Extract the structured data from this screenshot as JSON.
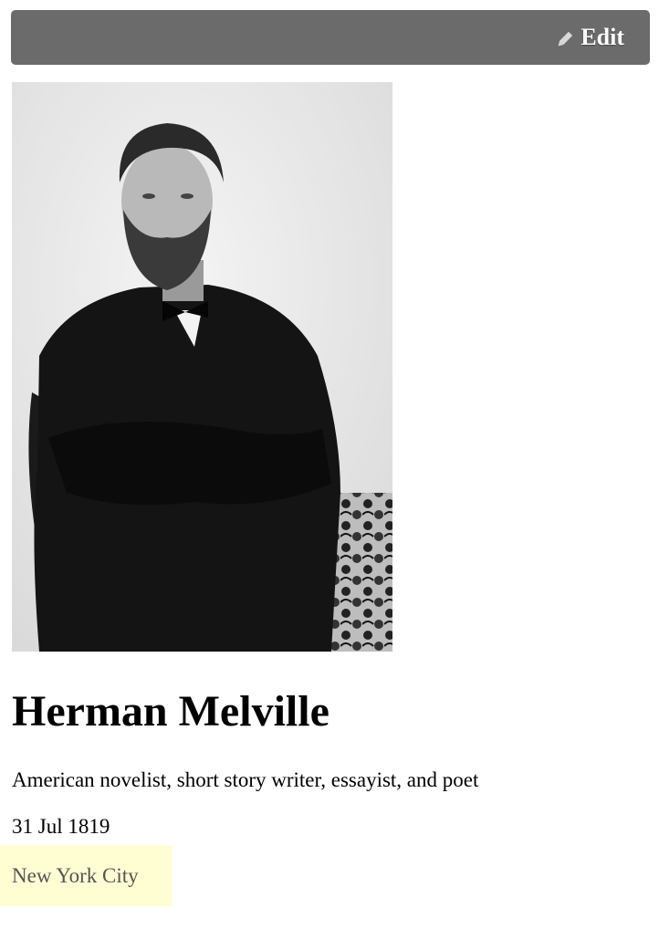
{
  "toolbar": {
    "edit_label": "Edit",
    "edit_icon": "pencil-icon"
  },
  "portrait": {
    "alt": "Herman Melville"
  },
  "person": {
    "name": "Herman Melville",
    "description": "American novelist, short story writer, essayist, and poet",
    "birth_date": "31 Jul 1819",
    "birth_place": "New York City"
  },
  "colors": {
    "toolbar_bg": "#6b6b6b",
    "highlight_bg": "#fffdd2",
    "place_text": "#555555"
  }
}
